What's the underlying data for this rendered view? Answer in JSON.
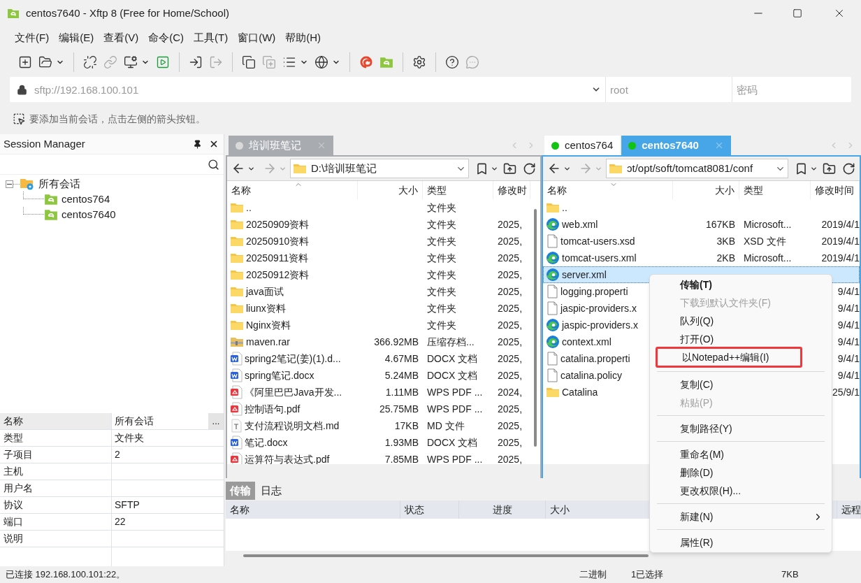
{
  "window": {
    "title": "centos7640 - Xftp 8 (Free for Home/School)"
  },
  "menu": [
    "文件(F)",
    "编辑(E)",
    "查看(V)",
    "命令(C)",
    "工具(T)",
    "窗口(W)",
    "帮助(H)"
  ],
  "address": {
    "url_placeholder": "sftp://192.168.100.101",
    "user_placeholder": "root",
    "password_placeholder": "密码"
  },
  "hint": "要添加当前会话，点击左侧的箭头按钮。",
  "session_manager": {
    "title": "Session Manager",
    "tree": [
      {
        "label": "所有会话",
        "kind": "folder",
        "expanded": true,
        "children": [
          {
            "label": "centos764",
            "kind": "session"
          },
          {
            "label": "centos7640",
            "kind": "session"
          }
        ]
      }
    ],
    "properties": [
      {
        "name": "名称",
        "value": "所有会话",
        "button": "..."
      },
      {
        "name": "类型",
        "value": "文件夹"
      },
      {
        "name": "子项目",
        "value": "2"
      },
      {
        "name": "主机"
      },
      {
        "name": "用户名"
      },
      {
        "name": "协议",
        "value": "SFTP"
      },
      {
        "name": "端口",
        "value": "22"
      },
      {
        "name": "说明"
      }
    ]
  },
  "local_pane": {
    "focused": false,
    "sorted_ascending": true,
    "path": "D:\\培训班笔记",
    "tabs": [
      {
        "label": "培训班笔记",
        "selected": true,
        "color": "#d9d9d9"
      }
    ],
    "columns": [
      "名称",
      "大小",
      "类型",
      "修改时"
    ],
    "rows": [
      {
        "kind": "folder",
        "name": "..",
        "type": "文件夹",
        "selected": false
      },
      {
        "kind": "folder",
        "name": "20250909资料",
        "type": "文件夹",
        "date": "2025,",
        "selected": false
      },
      {
        "kind": "folder",
        "name": "20250910资料",
        "type": "文件夹",
        "date": "2025,",
        "selected": false
      },
      {
        "kind": "folder",
        "name": "20250911资料",
        "type": "文件夹",
        "date": "2025,",
        "selected": false
      },
      {
        "kind": "folder",
        "name": "20250912资料",
        "type": "文件夹",
        "date": "2025,",
        "selected": false
      },
      {
        "kind": "folder",
        "name": "java面试",
        "type": "文件夹",
        "date": "2025,",
        "selected": false
      },
      {
        "kind": "folder",
        "name": "liunx资料",
        "type": "文件夹",
        "date": "2025,",
        "selected": false
      },
      {
        "kind": "folder",
        "name": "Nginx资料",
        "type": "文件夹",
        "date": "2025,",
        "selected": false
      },
      {
        "kind": "archive",
        "name": "maven.rar",
        "size": "366.92MB",
        "type": "压缩存档...",
        "date": "2025,",
        "selected": false
      },
      {
        "kind": "word",
        "name": "spring2笔记(姜)(1).d...",
        "size": "4.67MB",
        "type": "DOCX 文档",
        "date": "2025,",
        "selected": false
      },
      {
        "kind": "word",
        "name": "spring笔记.docx",
        "size": "5.24MB",
        "type": "DOCX 文档",
        "date": "2025,",
        "selected": false
      },
      {
        "kind": "pdf",
        "name": "《阿里巴巴Java开发...",
        "size": "1.11MB",
        "type": "WPS PDF ...",
        "date": "2024,",
        "selected": false
      },
      {
        "kind": "pdf",
        "name": "控制语句.pdf",
        "size": "25.75MB",
        "type": "WPS PDF ...",
        "date": "2025,",
        "selected": false
      },
      {
        "kind": "text",
        "name": "支付流程说明文档.md",
        "size": "17KB",
        "type": "MD 文件",
        "date": "2025,",
        "selected": false
      },
      {
        "kind": "word",
        "name": "笔记.docx",
        "size": "1.93MB",
        "type": "DOCX 文档",
        "date": "2025,",
        "selected": false
      },
      {
        "kind": "pdf",
        "name": "运算符与表达式.pdf",
        "size": "7.85MB",
        "type": "WPS PDF ...",
        "date": "2025,",
        "selected": false
      }
    ]
  },
  "remote_pane": {
    "focused": true,
    "sorted_ascending": false,
    "path": "ɔt/opt/soft/tomcat8081/conf",
    "tabs": [
      {
        "label": "centos764",
        "selected": false,
        "color": "#11c411"
      },
      {
        "label": "centos7640",
        "selected": true,
        "color": "#11c411"
      }
    ],
    "columns": [
      "名称",
      "大小",
      "类型",
      "修改时间"
    ],
    "rows": [
      {
        "kind": "folder",
        "name": "..",
        "selected": false
      },
      {
        "kind": "edge",
        "name": "web.xml",
        "size": "167KB",
        "type": "Microsoft...",
        "date": "2019/4/1",
        "selected": false
      },
      {
        "kind": "file",
        "name": "tomcat-users.xsd",
        "size": "3KB",
        "type": "XSD 文件",
        "date": "2019/4/1",
        "selected": false
      },
      {
        "kind": "edge",
        "name": "tomcat-users.xml",
        "size": "2KB",
        "type": "Microsoft...",
        "date": "2019/4/1",
        "selected": false
      },
      {
        "kind": "edge",
        "name": "server.xml",
        "selected": true
      },
      {
        "kind": "file",
        "name": "logging.properti",
        "date": "9/4/1",
        "selected": false
      },
      {
        "kind": "file",
        "name": "jaspic-providers.x",
        "date": "9/4/1",
        "selected": false
      },
      {
        "kind": "edge",
        "name": "jaspic-providers.x",
        "date": "9/4/1",
        "selected": false
      },
      {
        "kind": "edge",
        "name": "context.xml",
        "date": "9/4/1",
        "selected": false
      },
      {
        "kind": "file",
        "name": "catalina.properti",
        "date": "9/4/1",
        "selected": false
      },
      {
        "kind": "file",
        "name": "catalina.policy",
        "date": "9/4/1",
        "selected": false
      },
      {
        "kind": "folder",
        "name": "Catalina",
        "date": "25/9/1",
        "selected": false
      }
    ]
  },
  "transfer": {
    "tabs": [
      {
        "label": "传输",
        "selected": true
      },
      {
        "label": "日志",
        "selected": false
      }
    ],
    "columns": [
      "名称",
      "状态",
      "进度",
      "大小",
      "远程"
    ]
  },
  "context_menu": [
    {
      "kind": "item",
      "label": "传输(T)",
      "default": true
    },
    {
      "kind": "item",
      "label": "下载到默认文件夹(F)",
      "disabled": true
    },
    {
      "kind": "item",
      "label": "队列(Q)"
    },
    {
      "kind": "item",
      "label": "打开(O)"
    },
    {
      "kind": "item",
      "label": "以Notepad++编辑(I)",
      "highlighted": true
    },
    {
      "kind": "separator"
    },
    {
      "kind": "item",
      "label": "复制(C)"
    },
    {
      "kind": "item",
      "label": "粘贴(P)",
      "disabled": true
    },
    {
      "kind": "separator"
    },
    {
      "kind": "item",
      "label": "复制路径(Y)"
    },
    {
      "kind": "separator"
    },
    {
      "kind": "item",
      "label": "重命名(M)"
    },
    {
      "kind": "item",
      "label": "删除(D)"
    },
    {
      "kind": "item",
      "label": "更改权限(H)..."
    },
    {
      "kind": "separator"
    },
    {
      "kind": "item",
      "label": "新建(N)",
      "submenu": true
    },
    {
      "kind": "separator"
    },
    {
      "kind": "item",
      "label": "属性(R)"
    }
  ],
  "status": {
    "connection": "已连接 192.168.100.101:22。",
    "mode": "二进制",
    "selection": "1已选择",
    "size": "7KB"
  }
}
